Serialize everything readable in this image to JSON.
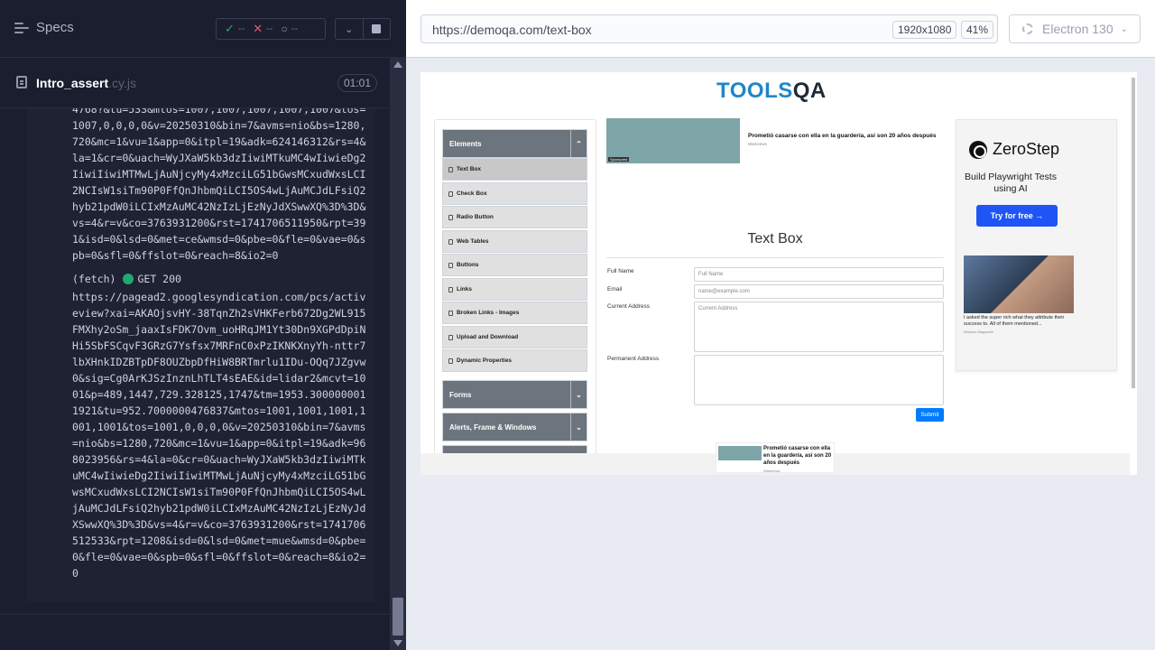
{
  "specs": {
    "title": "Specs"
  },
  "stats": {
    "passed": "--",
    "failed": "--",
    "pending": "--"
  },
  "file": {
    "name": "Intro_assert",
    "ext": ".cy.js",
    "duration": "01:01"
  },
  "log": {
    "top_text": "4768?&tu=533&mtos=1007,1007,1007,1007,1007&tos=1007,0,0,0,0&v=20250310&bin=7&avms=nio&bs=1280,720&mc=1&vu=1&app=0&itpl=19&adk=624146312&rs=4&la=1&cr=0&uach=WyJXaW5kb3dzIiwiMTkuMC4wIiwieDg2IiwiIiwiMTMwLjAuNjcyMy4xMzciLG51bGwsMCxudWxsLCI2NCIsW1siTm90P0FfQnJhbmQiLCI5OS4wLjAuMCJdLFsiQ2hyb21pdW0iLCIxMzAuMC42NzIzLjEzNyJdXSwwXQ%3D%3D&vs=4&r=v&co=3763931200&rst=1741706511950&rpt=391&isd=0&lsd=0&met=ce&wmsd=0&pbe=0&fle=0&vae=0&spb=0&sfl=0&ffslot=0&reach=8&io2=0",
    "fetch_label": "(fetch)",
    "fetch_status": "GET 200",
    "bottom_text": "https://pagead2.googlesyndication.com/pcs/activeview?xai=AKAOjsvHY-38TqnZh2sVHKFerb672Dg2WL915FMXhy2oSm_jaaxIsFDK7Ovm_uoHRqJM1Yt30Dn9XGPdDpiNHi5SbFSCqvF3GRzG7Ysfsx7MRFnC0xPzIKNKXnyYh-nttr7lbXHnkIDZBTpDF8OUZbpDfHiW8BRTmrlu1IDu-OQq7JZgvw0&sig=Cg0ArKJSzInznLhTLT4sEAE&id=lidar2&mcvt=1001&p=489,1447,729.328125,1747&tm=1953.3000000011921&tu=952.7000000476837&mtos=1001,1001,1001,1001,1001&tos=1001,0,0,0,0&v=20250310&bin=7&avms=nio&bs=1280,720&mc=1&vu=1&app=0&itpl=19&adk=968023956&rs=4&la=0&cr=0&uach=WyJXaW5kb3dzIiwiMTkuMC4wIiwieDg2IiwiIiwiMTMwLjAuNjcyMy4xMzciLG51bGwsMCxudWxsLCI2NCIsW1siTm90P0FfQnJhbmQiLCI5OS4wLjAuMCJdLFsiQ2hyb21pdW0iLCIxMzAuMC42NzIzLjEzNyJdXSwwXQ%3D%3D&vs=4&r=v&co=3763931200&rst=1741706512533&rpt=1208&isd=0&lsd=0&met=mue&wmsd=0&pbe=0&fle=0&vae=0&spb=0&sfl=0&ffslot=0&reach=8&io2=0"
  },
  "browser": {
    "url": "https://demoqa.com/text-box",
    "viewport": "1920x1080",
    "zoom": "41%",
    "engine": "Electron 130"
  },
  "aut": {
    "logo_tools": "TOOLS",
    "logo_qa": "QA",
    "groups": [
      {
        "label": "Elements"
      },
      {
        "label": "Forms"
      },
      {
        "label": "Alerts, Frame & Windows"
      }
    ],
    "menu": [
      "Text Box",
      "Check Box",
      "Radio Button",
      "Web Tables",
      "Buttons",
      "Links",
      "Broken Links - Images",
      "Upload and Download",
      "Dynamic Properties"
    ],
    "ad_top": {
      "badge": "Sponsored",
      "headline": "Prometió casarse con ella en la guardería, así son 20 años después",
      "source": "Wamnews"
    },
    "title": "Text Box",
    "fields": {
      "full_name_label": "Full Name",
      "full_name_placeholder": "Full Name",
      "email_label": "Email",
      "email_placeholder": "name@example.com",
      "current_label": "Current Address",
      "current_placeholder": "Current Address",
      "permanent_label": "Permanent Address"
    },
    "submit": "Submit",
    "ad_side": {
      "brand": "ZeroStep",
      "tagline": "Build Playwright Tests using AI",
      "cta": "Try for free →",
      "caption": "I asked the super rich what they attribute their success to. All of them mentioned...",
      "caption_src": "Wisdom Magazine"
    },
    "ad_bottom": {
      "headline": "Prometió casarse con ella en la guardería, así son 20 años después",
      "source": "Wamnews"
    }
  }
}
